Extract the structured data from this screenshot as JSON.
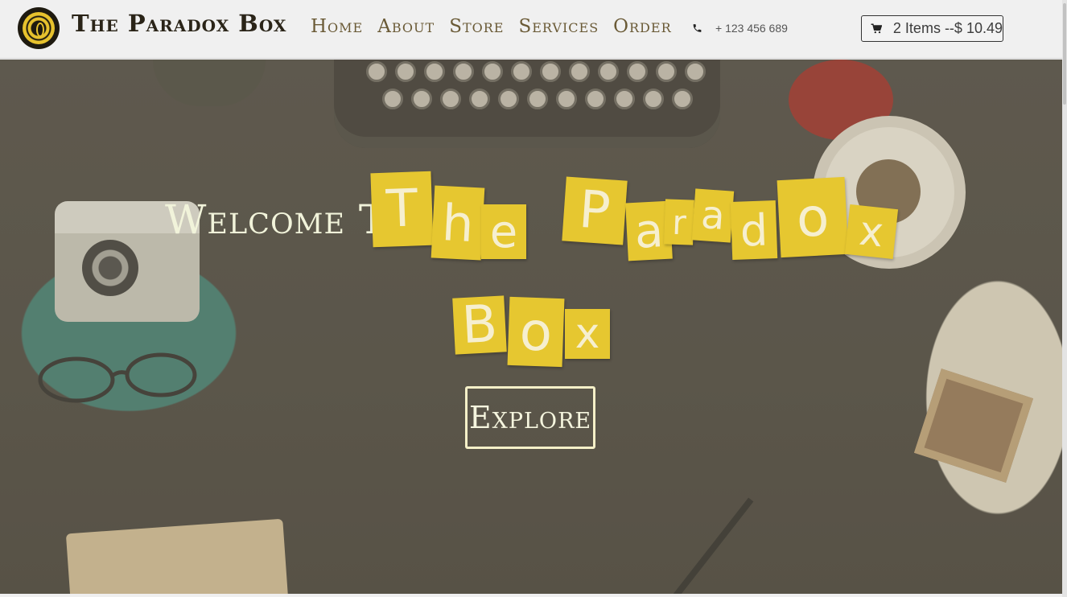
{
  "brand": {
    "name": "The Paradox Box"
  },
  "nav": {
    "items": [
      "Home",
      "About",
      "Store",
      "Services",
      "Order"
    ]
  },
  "contact": {
    "phone": "+ 123 456 689"
  },
  "cart": {
    "summary": "2 Items --$ 10.49"
  },
  "hero": {
    "welcome": "Welcome To",
    "tiles": [
      "T",
      "h",
      "e",
      "P",
      "a",
      "r",
      "a",
      "d",
      "o",
      "x",
      "B",
      "o",
      "x"
    ],
    "explore_label": "Explore"
  },
  "colors": {
    "tile": "#e6c730",
    "tile_text": "#f6efcf",
    "headline": "#f1f3da",
    "nav_text": "#6a5a36",
    "header_bg": "#f0f0f0"
  },
  "icons": {
    "logo": "sun-mandala-icon",
    "phone": "phone-icon",
    "cart": "cart-icon"
  }
}
